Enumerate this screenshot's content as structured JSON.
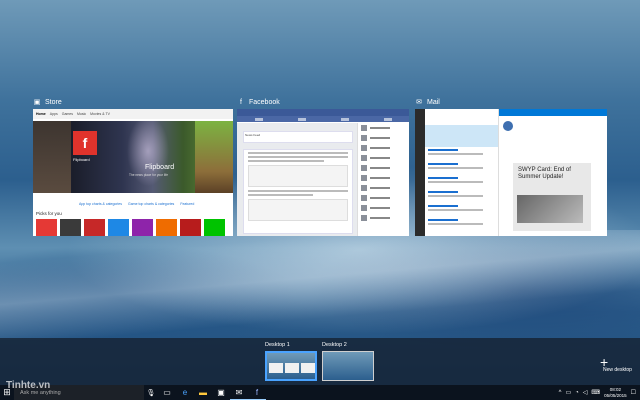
{
  "windows": [
    {
      "title": "Store",
      "icon": "store-icon"
    },
    {
      "title": "Facebook",
      "icon": "facebook-icon"
    },
    {
      "title": "Mail",
      "icon": "mail-icon"
    }
  ],
  "store": {
    "nav": [
      "Home",
      "Apps",
      "Games",
      "Music",
      "Movies & TV"
    ],
    "hero_app": "Flipboard",
    "hero_title": "Flipboard",
    "hero_sub": "The news place for your life",
    "links": [
      "App top charts & categories",
      "Game top charts & categories",
      "Featured"
    ],
    "picks_label": "Picks for you"
  },
  "facebook": {
    "compose_placeholder": "News Feed"
  },
  "mail": {
    "card_title": "SWYP Card: End of Summer Update!"
  },
  "desktops": [
    {
      "label": "Desktop 1",
      "active": true
    },
    {
      "label": "Desktop 2",
      "active": false
    }
  ],
  "new_desktop_label": "New desktop",
  "taskbar": {
    "search_placeholder": "Ask me anything",
    "time": "08:02",
    "date": "05/05/2015"
  },
  "watermark": "Tinhte.vn"
}
